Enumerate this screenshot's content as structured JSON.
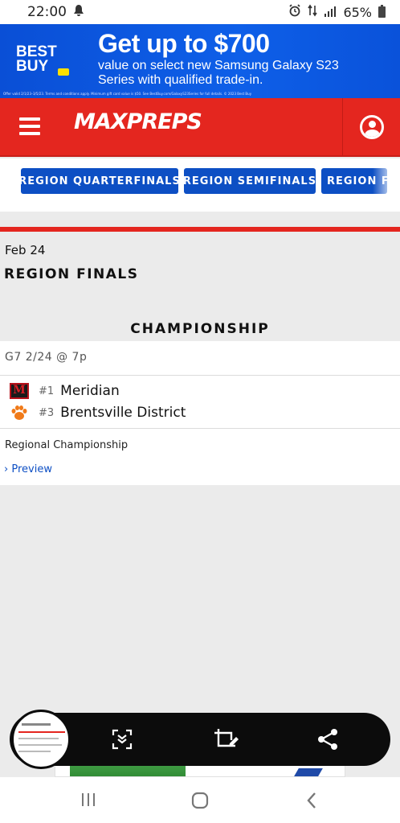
{
  "status_bar": {
    "time": "22:00",
    "battery": "65%"
  },
  "ad": {
    "brand": "BEST BUY",
    "headline": "Get up to $700",
    "subtext": "value on select new Samsung Galaxy S23 Series with qualified trade-in.",
    "fine_print": "Offer valid 2/1/23–3/5/23. Terms and conditions apply. Minimum gift card value is $50. See BestBuy.com/GalaxyS23Series for full details. © 2023 Best Buy"
  },
  "header": {
    "logo": "MAXPREPS"
  },
  "round_tabs": [
    {
      "label": "REGION QUARTERFINALS"
    },
    {
      "label": "REGION SEMIFINALS"
    },
    {
      "label": "REGION FI"
    }
  ],
  "section": {
    "date": "Feb 24",
    "round_title": "REGION FINALS",
    "bracket_title": "CHAMPIONSHIP"
  },
  "game": {
    "meta": "G7 2/24 @ 7p",
    "teams": [
      {
        "seed": "#1",
        "name": "Meridian",
        "logo_icon": "meridian-m-logo"
      },
      {
        "seed": "#3",
        "name": "Brentsville District",
        "logo_icon": "paw-logo"
      }
    ],
    "note": "Regional Championship",
    "preview_label": "Preview"
  },
  "colors": {
    "header_red": "#e4261f",
    "button_blue": "#0d4fc4",
    "ad_blue": "#0e5fe8"
  }
}
